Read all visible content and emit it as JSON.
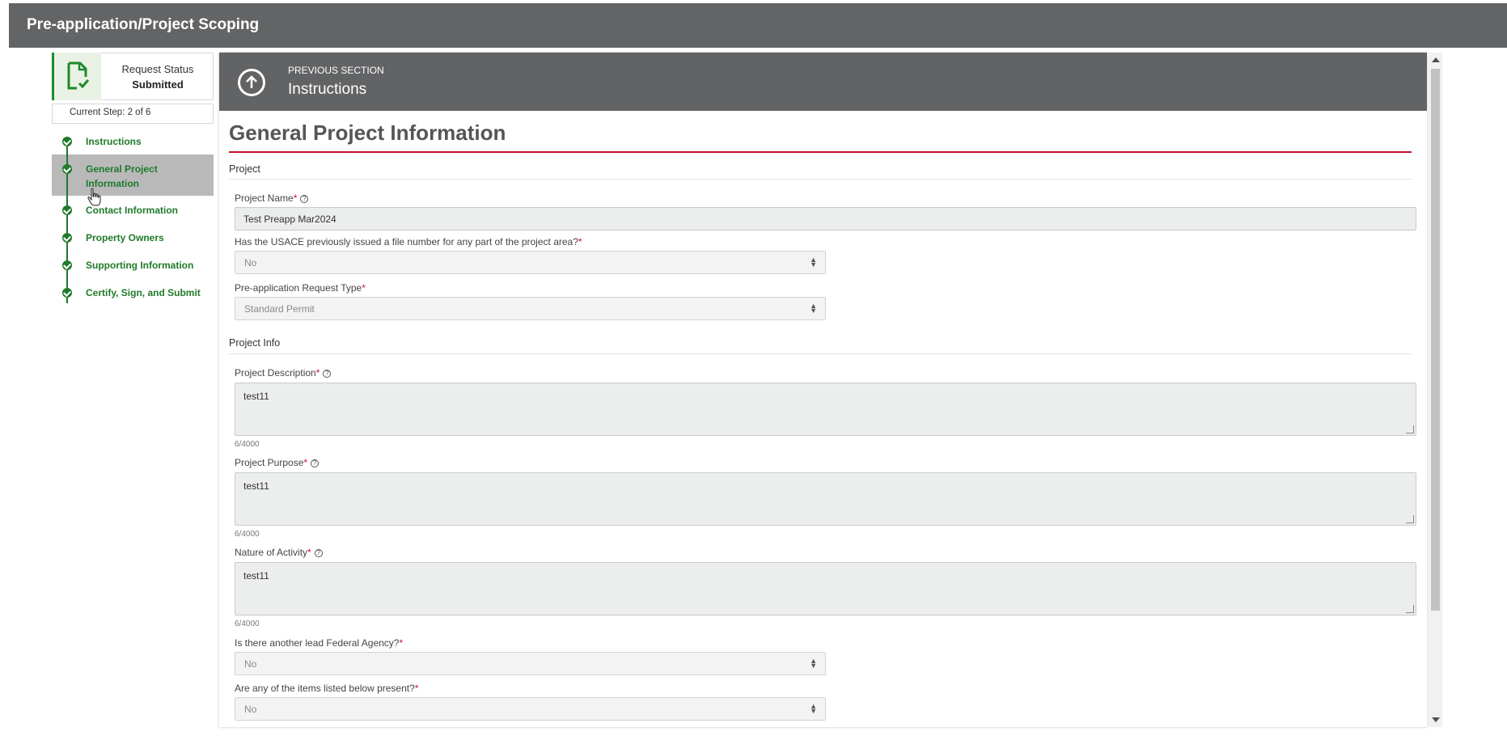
{
  "header": {
    "title": "Pre-application/Project Scoping"
  },
  "status": {
    "label": "Request Status",
    "value": "Submitted",
    "current_step": "Current Step: 2 of 6"
  },
  "steps": [
    {
      "label": "Instructions"
    },
    {
      "label": "General Project Information"
    },
    {
      "label": "Contact Information"
    },
    {
      "label": "Property Owners"
    },
    {
      "label": "Supporting Information"
    },
    {
      "label": "Certify, Sign, and Submit"
    }
  ],
  "previous_section": {
    "caption": "PREVIOUS SECTION",
    "name": "Instructions"
  },
  "form": {
    "title": "General Project Information",
    "sections": {
      "project": "Project",
      "project_info": "Project Info"
    },
    "project_name": {
      "label": "Project Name",
      "value": "Test Preapp Mar2024"
    },
    "file_number": {
      "label": "Has the USACE previously issued a file number for any part of the project area?",
      "value": "No"
    },
    "request_type": {
      "label": "Pre-application Request Type",
      "value": "Standard Permit"
    },
    "description": {
      "label": "Project Description",
      "value": "test11",
      "counter": "6/4000"
    },
    "purpose": {
      "label": "Project Purpose",
      "value": "test11",
      "counter": "6/4000"
    },
    "nature": {
      "label": "Nature of Activity",
      "value": "test11",
      "counter": "6/4000"
    },
    "lead_agency": {
      "label": "Is there another lead Federal Agency?",
      "value": "No"
    },
    "items_present": {
      "label": "Are any of the items listed below present?",
      "value": "No"
    }
  },
  "colors": {
    "accent_green": "#1f7a2a",
    "header_gray": "#636466",
    "rule_red": "#c8102e"
  }
}
